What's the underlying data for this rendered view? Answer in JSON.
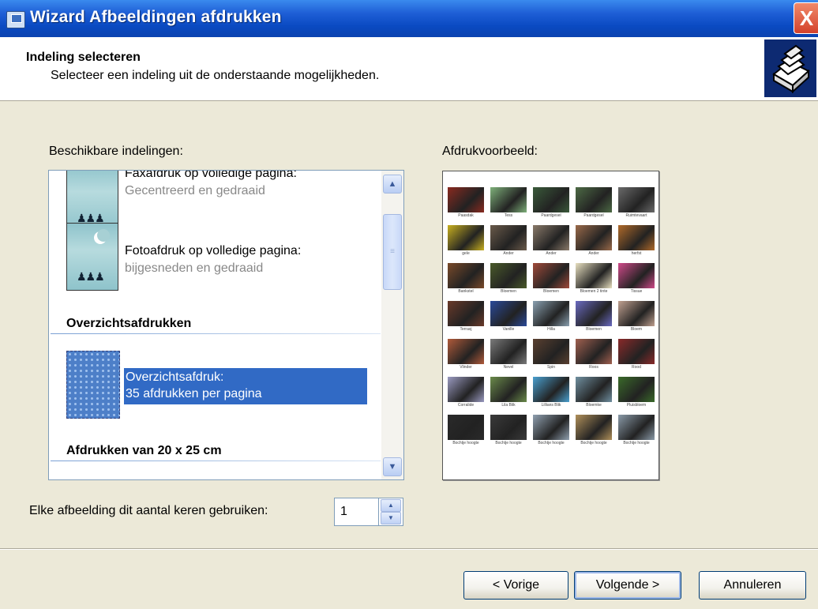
{
  "window": {
    "title": "Wizard Afbeeldingen afdrukken",
    "close_label": "X"
  },
  "header": {
    "title": "Indeling selecteren",
    "subtitle": "Selecteer een indeling uit de onderstaande mogelijkheden."
  },
  "layouts": {
    "label": "Beschikbare indelingen:",
    "items": [
      {
        "title": "Faxafdruk op volledige pagina:",
        "subtitle": "Gecentreerd en gedraaid"
      },
      {
        "title": "Fotoafdruk op volledige pagina:",
        "subtitle": "bijgesneden en gedraaid"
      }
    ],
    "groups": [
      "Overzichtsafdrukken",
      "Afdrukken van 20 x 25 cm"
    ],
    "selected": {
      "line1": "Overzichtsafdruk:",
      "line2": "35 afdrukken per pagina"
    }
  },
  "preview": {
    "label": "Afdrukvoorbeeld:",
    "thumbs": [
      {
        "caption": "Paasdak",
        "color": "#8a2a20"
      },
      {
        "caption": "Tess",
        "color": "#7fb07a"
      },
      {
        "caption": "Paardgesel",
        "color": "#3a5a3a"
      },
      {
        "caption": "Paardgesel",
        "color": "#4d6a45"
      },
      {
        "caption": "Ruimtevaart",
        "color": "#6a6a6a"
      },
      {
        "caption": "gele",
        "color": "#c8b020"
      },
      {
        "caption": "Ander",
        "color": "#6a5a4a"
      },
      {
        "caption": "Ander",
        "color": "#8a7a6a"
      },
      {
        "caption": "Ander",
        "color": "#9a6a4a"
      },
      {
        "caption": "herfst",
        "color": "#b06a2a"
      },
      {
        "caption": "Bankstel",
        "color": "#7a4a2a"
      },
      {
        "caption": "Bloemen",
        "color": "#4a5a2a"
      },
      {
        "caption": "Bloemen",
        "color": "#a04a3a"
      },
      {
        "caption": "Bloemen 2 tinte",
        "color": "#e8e0c0"
      },
      {
        "caption": "Tissue",
        "color": "#d04a8a"
      },
      {
        "caption": "Terrasj",
        "color": "#6a3a2a"
      },
      {
        "caption": "Vanille",
        "color": "#2a4a9a"
      },
      {
        "caption": "Hilla",
        "color": "#8aa0b0"
      },
      {
        "caption": "Bloemen",
        "color": "#6a6ac0"
      },
      {
        "caption": "Bloem",
        "color": "#c0a090"
      },
      {
        "caption": "Vlinder",
        "color": "#b05a3a"
      },
      {
        "caption": "Nevel",
        "color": "#7a7a7a"
      },
      {
        "caption": "Spin",
        "color": "#5a4030"
      },
      {
        "caption": "Roos",
        "color": "#a06050"
      },
      {
        "caption": "Rood",
        "color": "#8a2a2a"
      },
      {
        "caption": "Corralide",
        "color": "#9a9ac0"
      },
      {
        "caption": "Lila Blik",
        "color": "#6a8a4a"
      },
      {
        "caption": "Lillians Blik",
        "color": "#4aa0d0"
      },
      {
        "caption": "Bloemke",
        "color": "#7090a0"
      },
      {
        "caption": "Pluisbloem",
        "color": "#3a6a2a"
      },
      {
        "caption": "Bochtje hoogte",
        "color": "#2a2a2a"
      },
      {
        "caption": "Bochtje hoogte",
        "color": "#3a3a3a"
      },
      {
        "caption": "Bochtje hoogte",
        "color": "#90a0b0"
      },
      {
        "caption": "Bochtje hoogte",
        "color": "#b0905a"
      },
      {
        "caption": "Bochtje hoogte",
        "color": "#8a9aa8"
      }
    ]
  },
  "copies": {
    "label": "Elke afbeelding dit aantal keren gebruiken:",
    "value": "1"
  },
  "footer": {
    "back_label": "< Vorige",
    "next_label": "Volgende >",
    "cancel_label": "Annuleren"
  }
}
